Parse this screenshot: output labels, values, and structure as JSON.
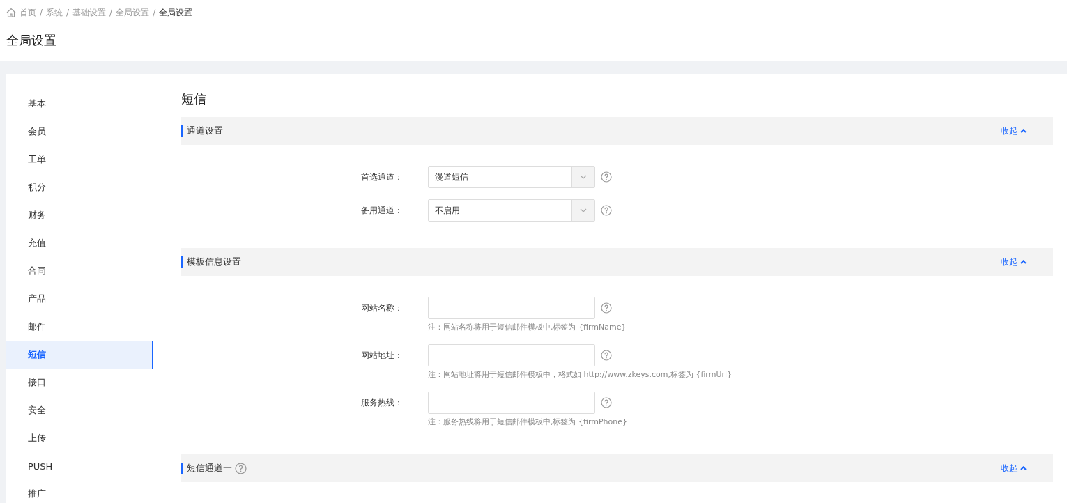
{
  "breadcrumb": [
    {
      "label": "首页",
      "current": false
    },
    {
      "separator": "/",
      "label": "系统",
      "current": false
    },
    {
      "separator": "/",
      "label": "基础设置",
      "current": false
    },
    {
      "separator": "/",
      "label": "全局设置",
      "current": false
    },
    {
      "separator": "/",
      "label": "全局设置",
      "current": true
    }
  ],
  "page_title": "全局设置",
  "sidebar": {
    "items": [
      {
        "label": "基本",
        "selected": false
      },
      {
        "label": "会员",
        "selected": false
      },
      {
        "label": "工单",
        "selected": false
      },
      {
        "label": "积分",
        "selected": false
      },
      {
        "label": "财务",
        "selected": false
      },
      {
        "label": "充值",
        "selected": false
      },
      {
        "label": "合同",
        "selected": false
      },
      {
        "label": "产品",
        "selected": false
      },
      {
        "label": "邮件",
        "selected": false
      },
      {
        "label": "短信",
        "selected": true
      },
      {
        "label": "接口",
        "selected": false
      },
      {
        "label": "安全",
        "selected": false
      },
      {
        "label": "上传",
        "selected": false
      },
      {
        "label": "PUSH",
        "selected": false
      },
      {
        "label": "推广",
        "selected": false
      }
    ]
  },
  "content_title": "短信",
  "sections": [
    {
      "title": "通道设置",
      "help": false,
      "toggle": "收起",
      "expanded": true,
      "fields": [
        {
          "label": "首选通道：",
          "kind": "select",
          "value": "漫道短信"
        },
        {
          "label": "备用通道：",
          "kind": "select",
          "value": "不启用"
        }
      ]
    },
    {
      "title": "模板信息设置",
      "help": false,
      "toggle": "收起",
      "expanded": true,
      "fields": [
        {
          "label": "网站名称：",
          "kind": "input",
          "note": "注：网站名称将用于短信邮件模板中,标签为 {firmName}"
        },
        {
          "label": "网站地址：",
          "kind": "input",
          "note": "注：网站地址将用于短信邮件模板中，格式如 http://www.zkeys.com,标签为 {firmUrl}"
        },
        {
          "label": "服务热线：",
          "kind": "input",
          "note": "注：服务热线将用于短信邮件模板中,标签为 {firmPhone}"
        }
      ]
    },
    {
      "title": "短信通道一",
      "help": true,
      "toggle": "收起",
      "expanded": true
    }
  ]
}
